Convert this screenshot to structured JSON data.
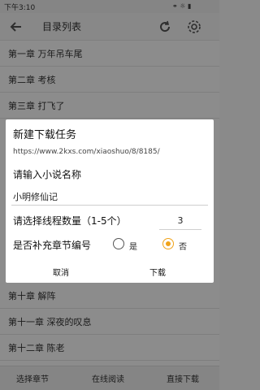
{
  "status": {
    "time": "下午3:10",
    "icons": "⚭ ☼ ▮"
  },
  "appbar": {
    "title": "目录列表"
  },
  "chapters": [
    "第一章 万年吊车尾",
    "第二章 考核",
    "第三章 打飞了",
    "",
    "",
    "",
    "",
    "第十章 解阵",
    "第十一章 深夜的叹息",
    "第十二章 陈老"
  ],
  "bottom": {
    "select": "选择章节",
    "read": "在线阅读",
    "download": "直接下载"
  },
  "dialog": {
    "title": "新建下载任务",
    "url": "https://www.2kxs.com/xiaoshuo/8/8185/",
    "name_label": "请输入小说名称",
    "name_value": "小明修仙记",
    "thread_label": "请选择线程数量（1-5个）",
    "thread_value": "3",
    "numbering_label": "是否补充章节编号",
    "yes_label": "是",
    "no_label": "否",
    "selected": "否",
    "cancel": "取消",
    "download": "下载"
  },
  "colors": {
    "accent": "#f0a31a",
    "overlay": "rgba(0,0,0,0.45)"
  }
}
